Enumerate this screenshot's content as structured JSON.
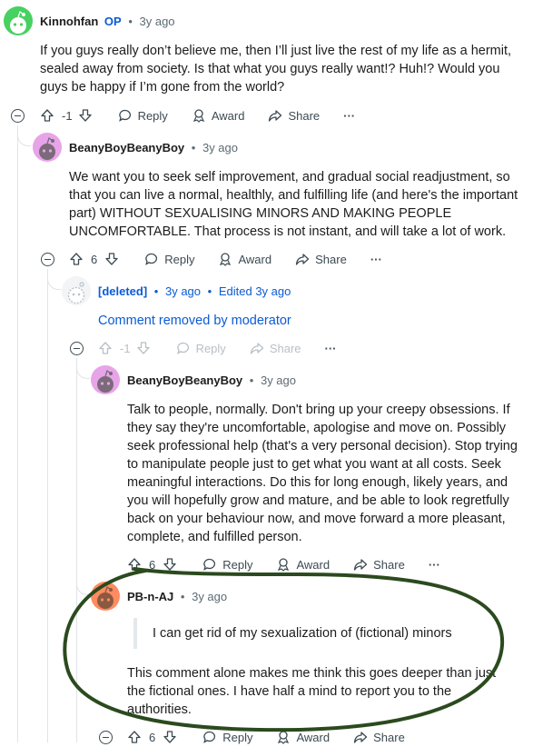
{
  "comments": [
    {
      "author": "Kinnohfan",
      "op_badge": "OP",
      "time": "3y ago",
      "body": "If you guys really don’t believe me, then I’ll just live the rest of my life as a hermit, sealed away from society. Is that what you guys really want!? Huh!? Would you guys be happy if I’m gone from the world?",
      "votes": "-1"
    },
    {
      "author": "BeanyBoyBeanyBoy",
      "time": "3y ago",
      "body": "We want you to seek self improvement, and gradual social readjustment, so that you can live a normal, healthly, and fulfilling life (and here's the important part) WITHOUT SEXUALISING MINORS AND MAKING PEOPLE UNCOMFORTABLE. That process is not instant, and will take a lot of work.",
      "votes": "6"
    },
    {
      "author": "[deleted]",
      "time": "3y ago",
      "edited": "Edited 3y ago",
      "body": "Comment removed by moderator",
      "votes": "-1"
    },
    {
      "author": "BeanyBoyBeanyBoy",
      "time": "3y ago",
      "body": "Talk to people, normally. Don't bring up your creepy obsessions. If they say they're uncomfortable, apologise and move on. Possibly seek professional help (that's a very personal decision). Stop trying to manipulate people just to get what you want at all costs. Seek meaningful interactions. Do this for long enough, likely years, and you will hopefully grow and mature, and be able to look regretfully back on your behaviour now, and move forward a more pleasant, complete, and fulfilled person.",
      "votes": "6"
    },
    {
      "author": "PB-n-AJ",
      "time": "3y ago",
      "quote": "I can get rid of my sexualization of (fictional) minors",
      "body": "This comment alone makes me think this goes deeper than just the fictional ones. I have half a mind to report you to the authorities.",
      "votes": "6"
    }
  ],
  "actions": {
    "reply": "Reply",
    "award": "Award",
    "share": "Share",
    "more": "···"
  },
  "colors": {
    "accent_blue": "#0a5bd6",
    "annotation_green": "#2b4a1e",
    "avatar_green": "#46d160",
    "avatar_pink": "#e7a4e8",
    "avatar_orange": "#ff8b60"
  }
}
